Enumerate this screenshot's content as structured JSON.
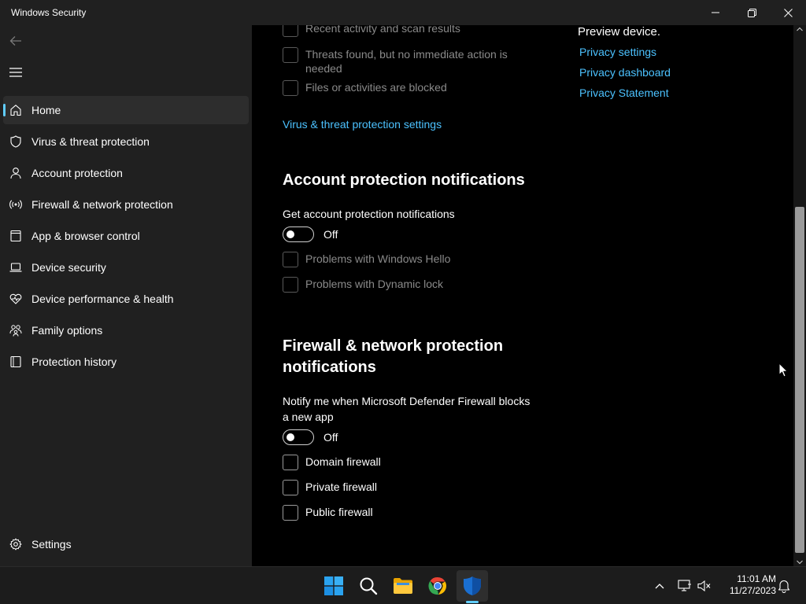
{
  "window": {
    "title": "Windows Security"
  },
  "sidebar": {
    "items": [
      {
        "label": "Home",
        "icon": "home-icon"
      },
      {
        "label": "Virus & threat protection",
        "icon": "shield-icon"
      },
      {
        "label": "Account protection",
        "icon": "person-icon"
      },
      {
        "label": "Firewall & network protection",
        "icon": "wireless-icon"
      },
      {
        "label": "App & browser control",
        "icon": "app-window-icon"
      },
      {
        "label": "Device security",
        "icon": "laptop-icon"
      },
      {
        "label": "Device performance & health",
        "icon": "heart-pulse-icon"
      },
      {
        "label": "Family options",
        "icon": "family-icon"
      },
      {
        "label": "Protection history",
        "icon": "history-icon"
      }
    ],
    "settings_label": "Settings"
  },
  "virus_section": {
    "options": [
      {
        "label": "Recent activity and scan results"
      },
      {
        "label": "Threats found, but no immediate action is needed"
      },
      {
        "label": "Files or activities are blocked"
      }
    ],
    "settings_link": "Virus & threat protection settings"
  },
  "privacy_panel": {
    "preview_text": "Preview device.",
    "links": [
      "Privacy settings",
      "Privacy dashboard",
      "Privacy Statement"
    ]
  },
  "account_section": {
    "heading": "Account protection notifications",
    "toggle_label": "Get account protection notifications",
    "toggle_state": "Off",
    "options": [
      {
        "label": "Problems with Windows Hello"
      },
      {
        "label": "Problems with Dynamic lock"
      }
    ]
  },
  "firewall_section": {
    "heading": "Firewall & network protection notifications",
    "toggle_label": "Notify me when Microsoft Defender Firewall blocks a new app",
    "toggle_state": "Off",
    "options": [
      {
        "label": "Domain firewall"
      },
      {
        "label": "Private firewall"
      },
      {
        "label": "Public firewall"
      }
    ]
  },
  "taskbar": {
    "time": "11:01 AM",
    "date": "11/27/2023"
  },
  "colors": {
    "accent": "#60cdff",
    "link": "#4cc2ff",
    "sidebar_bg": "#202020",
    "content_bg": "#000000"
  }
}
